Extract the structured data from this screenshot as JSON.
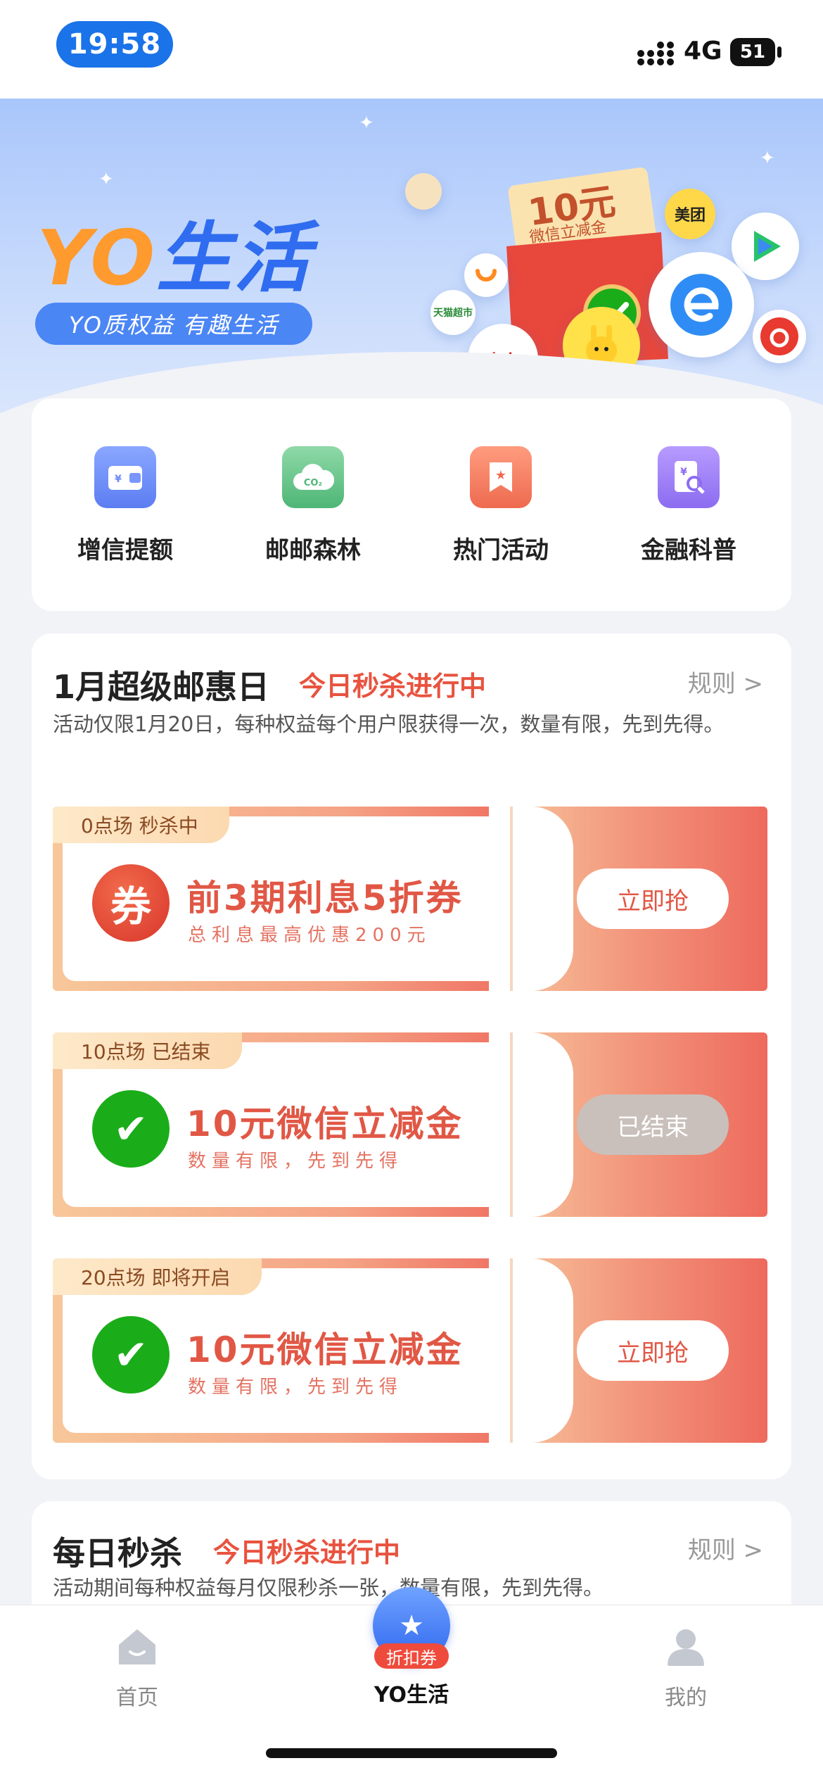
{
  "status_bar": {
    "time": "19:58",
    "network": "4G",
    "battery": "51"
  },
  "banner": {
    "title_yo": "YO",
    "title_life": "生活",
    "subtitle": "YO质权益 有趣生活",
    "badges": {
      "coupon_amount": "10元",
      "coupon_caption": "微信立减金",
      "meituan": "美团",
      "jd": "京东",
      "tmall": "天猫超市"
    }
  },
  "quick_entries": [
    {
      "label": "增信提额",
      "icon": "wallet-icon",
      "color": "#6f8cf6"
    },
    {
      "label": "邮邮森林",
      "icon": "cloud-co2-icon",
      "color": "#5fbf84"
    },
    {
      "label": "热门活动",
      "icon": "ribbon-star-icon",
      "color": "#f2785c"
    },
    {
      "label": "金融科普",
      "icon": "document-search-icon",
      "color": "#9b7bf0"
    }
  ],
  "event": {
    "title": "1月超级邮惠日",
    "status": "今日秒杀进行中",
    "rules": "规则 >",
    "description": "活动仅限1月20日，每种权益每个用户限获得一次，数量有限，先到先得。",
    "coupons": [
      {
        "tag": "0点场 秒杀中",
        "title": "前3期利息5折券",
        "subtitle": "总利息最高优惠200元",
        "button": "立即抢",
        "icon_text": "券",
        "ended": false
      },
      {
        "tag": "10点场 已结束",
        "title": "10元微信立减金",
        "subtitle": "数量有限，先到先得",
        "button": "已结束",
        "icon_text": "✔",
        "ended": true
      },
      {
        "tag": "20点场 即将开启",
        "title": "10元微信立减金",
        "subtitle": "数量有限，先到先得",
        "button": "立即抢",
        "icon_text": "✔",
        "ended": false
      }
    ]
  },
  "daily": {
    "title": "每日秒杀",
    "status": "今日秒杀进行中",
    "rules": "规则 >",
    "description": "活动期间每种权益每月仅限秒杀一张，数量有限，先到先得。"
  },
  "tabbar": {
    "home": "首页",
    "yo": "YO生活",
    "badge": "折扣券",
    "mine": "我的"
  }
}
